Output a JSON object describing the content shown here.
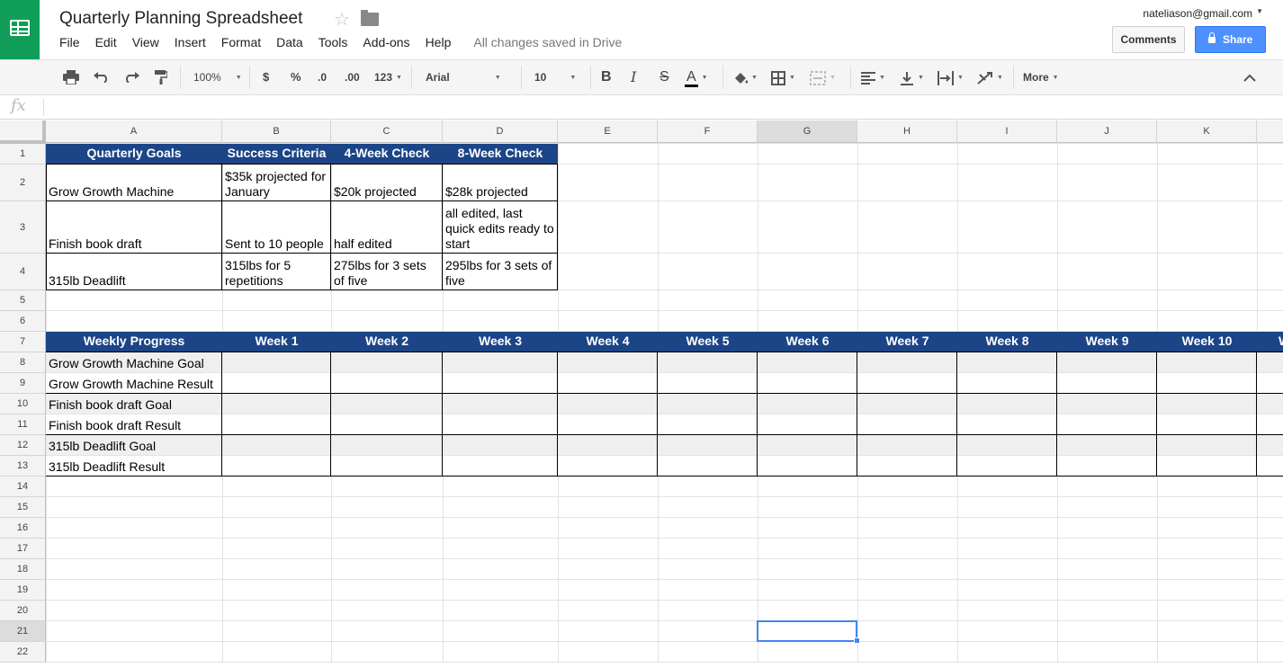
{
  "document": {
    "title": "Quarterly Planning Spreadsheet",
    "save_status": "All changes saved in Drive",
    "menu": [
      "File",
      "Edit",
      "View",
      "Insert",
      "Format",
      "Data",
      "Tools",
      "Add-ons",
      "Help"
    ],
    "user_email": "nateliason@gmail.com",
    "comments_label": "Comments",
    "share_label": "Share",
    "brand_color": "#0f9d58",
    "share_color": "#4d90fe"
  },
  "toolbar": {
    "zoom": "100%",
    "currency": "$",
    "percent": "%",
    "decrease_decimal": ".0",
    "increase_decimal": ".00",
    "more_formats": "123",
    "font": "Arial",
    "font_size": "10",
    "bold": "B",
    "italic": "I",
    "strike": "S",
    "text_color": "A",
    "more": "More",
    "icons": [
      "print-icon",
      "undo-icon",
      "redo-icon",
      "paint-format-icon",
      "fill-color-icon",
      "borders-icon",
      "merge-icon",
      "align-icon",
      "valign-icon",
      "wrap-icon",
      "rotate-icon",
      "collapse-icon"
    ]
  },
  "formula_bar": {
    "fx": "fx",
    "value": ""
  },
  "sheet": {
    "columns": [
      "A",
      "B",
      "C",
      "D",
      "E",
      "F",
      "G",
      "H",
      "I",
      "J",
      "K"
    ],
    "rows": [
      "1",
      "2",
      "3",
      "4",
      "5",
      "6",
      "7",
      "8",
      "9",
      "10",
      "11",
      "12",
      "13",
      "14",
      "15",
      "16",
      "17",
      "18",
      "19",
      "20",
      "21",
      "22"
    ],
    "selected_cell": "G21",
    "header_fill": "#1c4587",
    "goals_table": {
      "headers": [
        "Quarterly Goals",
        "Success Criteria",
        "4-Week Check",
        "8-Week Check"
      ],
      "rows": [
        [
          "Grow Growth Machine",
          "$35k projected for January",
          "$20k projected",
          "$28k projected"
        ],
        [
          "Finish book draft",
          "Sent to 10 people",
          "half edited",
          "all edited, last quick edits ready to start"
        ],
        [
          "315lb Deadlift",
          "315lbs for 5 repetitions",
          "275lbs for 3 sets of five",
          "295lbs for 3 sets of five"
        ]
      ]
    },
    "progress_table": {
      "headers": [
        "Weekly Progress",
        "Week 1",
        "Week 2",
        "Week 3",
        "Week 4",
        "Week 5",
        "Week 6",
        "Week 7",
        "Week 8",
        "Week 9",
        "Week 10",
        "W"
      ],
      "rows": [
        "Grow Growth Machine Goal",
        "Grow Growth Machine Result",
        "Finish book draft Goal",
        "Finish book draft Result",
        "315lb Deadlift Goal",
        "315lb Deadlift Result"
      ]
    }
  }
}
